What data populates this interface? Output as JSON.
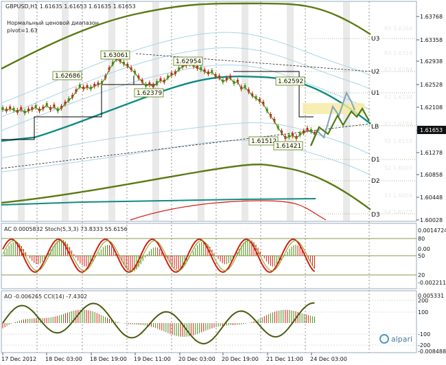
{
  "header": {
    "title": "GBPUSD,H1  1.61635 1.61653 1.61635 1.61653",
    "note_line1": "Нормальный ценовой диапазон",
    "note_line2": "pivot=1.63"
  },
  "price_axis": {
    "ticks": [
      "1.63768",
      "1.63358",
      "1.62938",
      "1.62528",
      "1.62108",
      "1.61698",
      "1.61278",
      "1.60858",
      "1.60448",
      "1.60028"
    ],
    "current": "1.61653"
  },
  "pivot_levels": [
    {
      "name": "U3",
      "value": ""
    },
    {
      "name": "U2",
      "value": ""
    },
    {
      "name": "U1",
      "value": ""
    },
    {
      "name": "LB",
      "value": ""
    },
    {
      "name": "D1",
      "value": ""
    },
    {
      "name": "D2",
      "value": ""
    },
    {
      "name": "D3",
      "value": ""
    }
  ],
  "pivot_texts": [
    "R5 1.6364",
    "R4 1.6314",
    "R3 1.6284",
    "R2 1.6234",
    "R1 1.6184",
    "S1 1.6153",
    "S2 1.6103",
    "S3 1.6054",
    "S4 1.6023"
  ],
  "price_labels": [
    "1.63061",
    "1.62954",
    "1.62686",
    "1.62379",
    "1.62592",
    "1.61512",
    "1.61421"
  ],
  "time_axis": [
    "17 Dec 2012",
    "18 Dec 03:00",
    "18 Dec 19:00",
    "19 Dec 11:00",
    "20 Dec 03:00",
    "20 Dec 19:00",
    "21 Dec 11:00",
    "24 Dec 03:00"
  ],
  "ac_panel": {
    "title": "AC 0.0005832  Stoch(5,3,3) 73.8333 55.6156",
    "ticks": [
      "0.0014724",
      "80",
      "0.00",
      "50",
      "20",
      "-0.0022118"
    ]
  },
  "ao_panel": {
    "title": "AO -0.006265  CCI(14) -7.4302",
    "ticks": [
      "0.005331",
      "200",
      "100",
      "-100",
      "-200",
      "-0.008488"
    ]
  },
  "watermark": "alpari",
  "colors": {
    "olive": "#5a7a12",
    "teal": "#0f8a82",
    "red": "#d81a10",
    "green_line": "#4a8a14",
    "forecast": "#8aa8b8",
    "yellow_zone": "#f6eaa0"
  }
}
